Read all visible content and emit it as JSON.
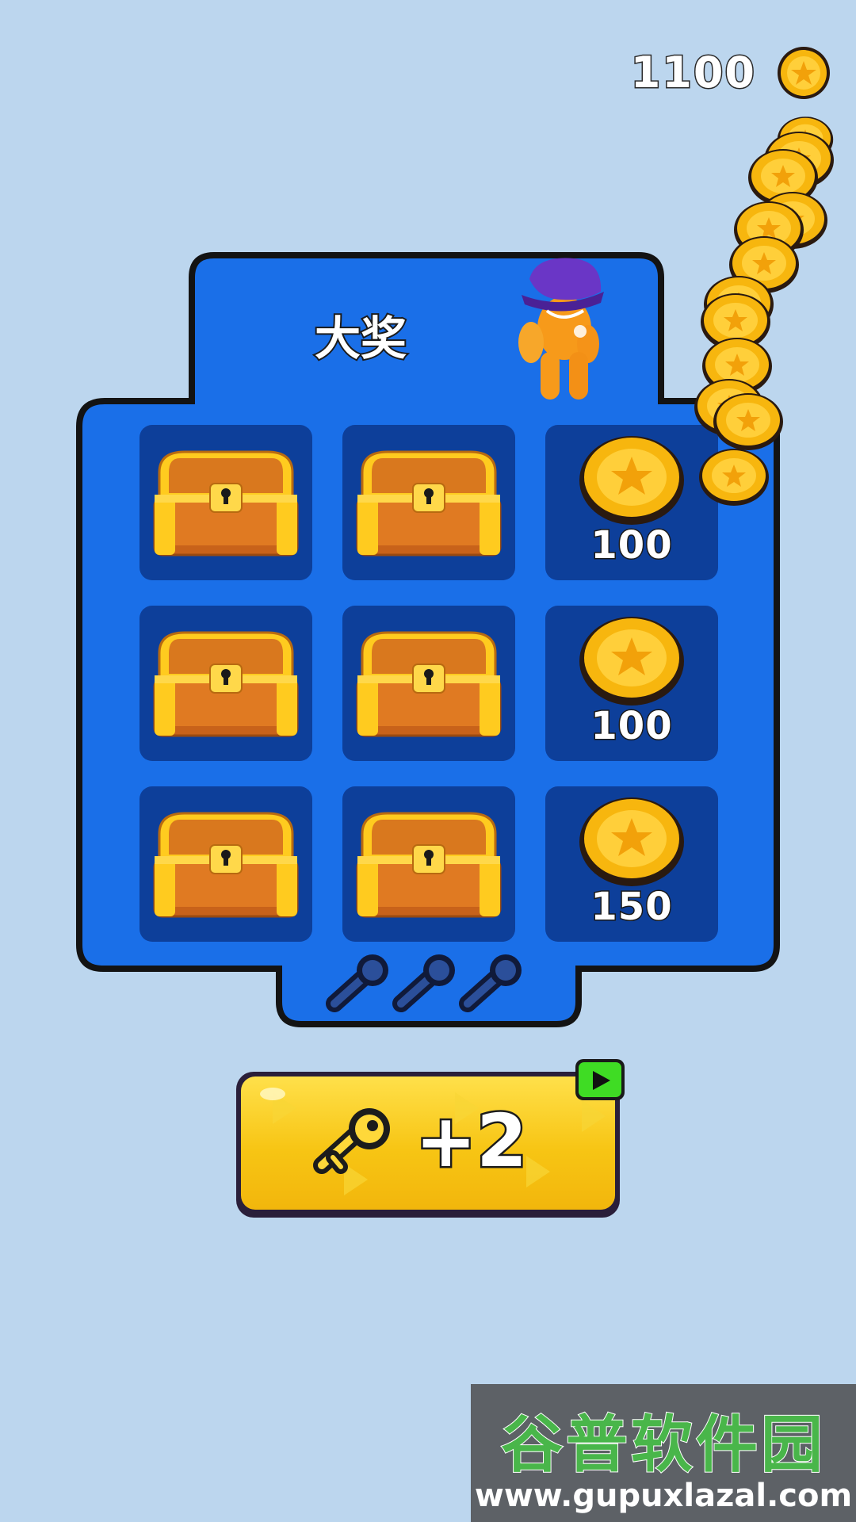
{
  "hud": {
    "coin_count": "1100",
    "coin_icon": "star-coin-icon"
  },
  "board": {
    "title": "大奖",
    "mascot": "orange-character-purple-hat",
    "tiles": [
      {
        "kind": "chest"
      },
      {
        "kind": "chest"
      },
      {
        "kind": "coin",
        "value": "100"
      },
      {
        "kind": "chest"
      },
      {
        "kind": "chest"
      },
      {
        "kind": "coin",
        "value": "100"
      },
      {
        "kind": "chest"
      },
      {
        "kind": "chest"
      },
      {
        "kind": "coin",
        "value": "150"
      }
    ],
    "keys_remaining": 0,
    "keys_total": 3
  },
  "add_key_button": {
    "label": "+2",
    "icon": "key-icon",
    "badge_icon": "video-play-icon"
  },
  "watermark": {
    "brand": "谷普软件园",
    "url": "www.gupuxlazal.com"
  },
  "colors": {
    "background": "#bcd6ee",
    "board_blue": "#1a6fe8",
    "tile_navy": "#0d3f9a",
    "coin_gold": "#f7b60e",
    "button_yellow": "#f7c514",
    "badge_green": "#3fdc24"
  }
}
